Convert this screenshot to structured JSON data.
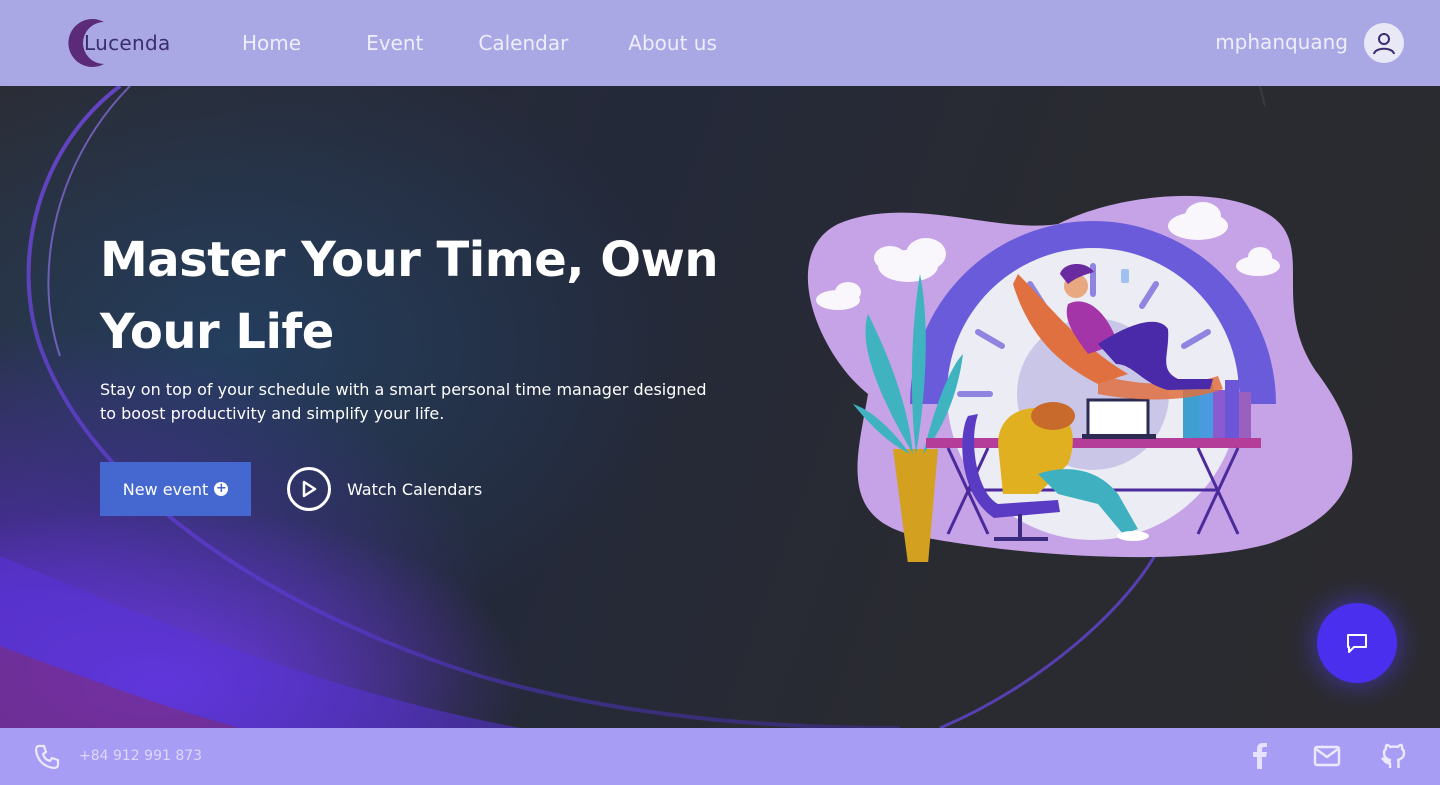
{
  "header": {
    "logo_text": "Lucenda",
    "nav": [
      "Home",
      "Event",
      "Calendar",
      "About us"
    ],
    "username": "mphanquang",
    "avatar_icon": "user-icon"
  },
  "hero": {
    "headline_line1": "Master Your Time, Own",
    "headline_line2": "Your Life",
    "subtext": "Stay on top of your schedule with a smart personal time manager designed to boost productivity and simplify your life.",
    "new_event_label": "New event",
    "new_event_icon": "plus-circle-icon",
    "watch_label": "Watch Calendars",
    "watch_icon": "play-icon",
    "chat_icon": "chat-icon"
  },
  "footer": {
    "phone": "+84 912 991 873",
    "phone_icon": "phone-icon",
    "social_icons": [
      "facebook-icon",
      "mail-icon",
      "github-icon"
    ]
  },
  "colors": {
    "header_bg": "#aaa8e4",
    "footer_bg": "#a89df5",
    "button_bg": "#4468cf",
    "chat_bg": "#4a2fef",
    "accent_purple": "#6a3ee0"
  }
}
